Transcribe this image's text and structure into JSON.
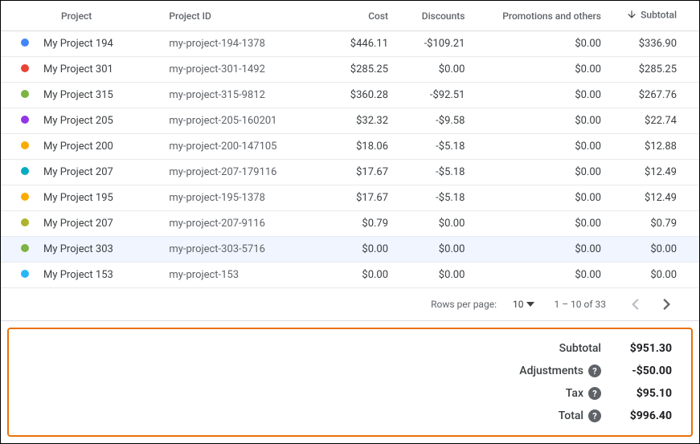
{
  "columns": {
    "project": "Project",
    "projectId": "Project ID",
    "cost": "Cost",
    "discounts": "Discounts",
    "promo": "Promotions and others",
    "subtotal": "Subtotal"
  },
  "rows": [
    {
      "color": "#4285f4",
      "project": "My Project 194",
      "projectId": "my-project-194-1378",
      "cost": "$446.11",
      "discounts": "-$109.21",
      "promo": "$0.00",
      "subtotal": "$336.90",
      "highlighted": false
    },
    {
      "color": "#ea4335",
      "project": "My Project 301",
      "projectId": "my-project-301-1492",
      "cost": "$285.25",
      "discounts": "$0.00",
      "promo": "$0.00",
      "subtotal": "$285.25",
      "highlighted": false
    },
    {
      "color": "#7cb342",
      "project": "My Project 315",
      "projectId": "my-project-315-9812",
      "cost": "$360.28",
      "discounts": "-$92.51",
      "promo": "$0.00",
      "subtotal": "$267.76",
      "highlighted": false
    },
    {
      "color": "#9334e6",
      "project": "My Project 205",
      "projectId": "my-project-205-160201",
      "cost": "$32.32",
      "discounts": "-$9.58",
      "promo": "$0.00",
      "subtotal": "$22.74",
      "highlighted": false
    },
    {
      "color": "#f9ab00",
      "project": "My Project 200",
      "projectId": "my-project-200-147105",
      "cost": "$18.06",
      "discounts": "-$5.18",
      "promo": "$0.00",
      "subtotal": "$12.88",
      "highlighted": false
    },
    {
      "color": "#00acc1",
      "project": "My Project 207",
      "projectId": "my-project-207-179116",
      "cost": "$17.67",
      "discounts": "-$5.18",
      "promo": "$0.00",
      "subtotal": "$12.49",
      "highlighted": false
    },
    {
      "color": "#f9ab00",
      "project": "My Project 195",
      "projectId": "my-project-195-1378",
      "cost": "$17.67",
      "discounts": "-$5.18",
      "promo": "$0.00",
      "subtotal": "$12.49",
      "highlighted": false
    },
    {
      "color": "#afb42b",
      "project": "My Project 207",
      "projectId": "my-project-207-9116",
      "cost": "$0.79",
      "discounts": "$0.00",
      "promo": "$0.00",
      "subtotal": "$0.79",
      "highlighted": false
    },
    {
      "color": "#7cb342",
      "project": "My Project 303",
      "projectId": "my-project-303-5716",
      "cost": "$0.00",
      "discounts": "$0.00",
      "promo": "$0.00",
      "subtotal": "$0.00",
      "highlighted": true
    },
    {
      "color": "#29b6f6",
      "project": "My Project 153",
      "projectId": "my-project-153",
      "cost": "$0.00",
      "discounts": "$0.00",
      "promo": "$0.00",
      "subtotal": "$0.00",
      "highlighted": false
    }
  ],
  "pagination": {
    "rowsPerPageLabel": "Rows per page:",
    "rowsPerPageValue": "10",
    "rangeText": "1 – 10 of 33"
  },
  "summary": {
    "subtotal": {
      "label": "Subtotal",
      "value": "$951.30",
      "help": false
    },
    "adjustments": {
      "label": "Adjustments",
      "value": "-$50.00",
      "help": true
    },
    "tax": {
      "label": "Tax",
      "value": "$95.10",
      "help": true
    },
    "total": {
      "label": "Total",
      "value": "$996.40",
      "help": true
    }
  }
}
